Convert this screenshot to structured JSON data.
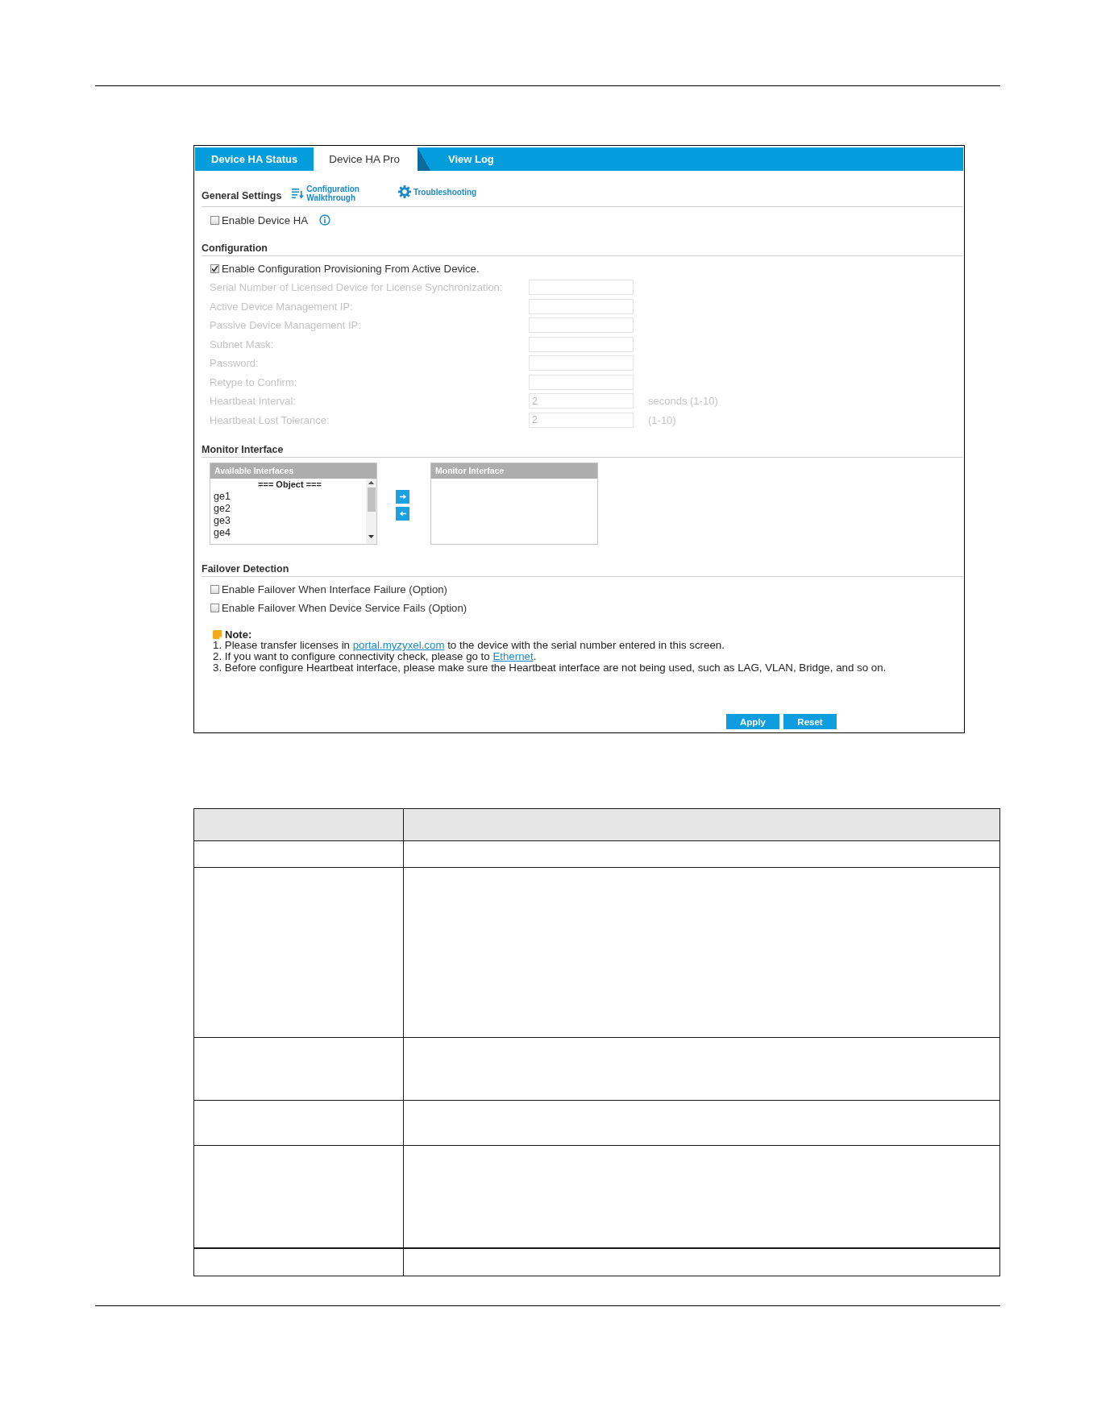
{
  "tabs": [
    {
      "label": "Device HA Status",
      "selected": false
    },
    {
      "label": "Device HA Pro",
      "selected": true
    },
    {
      "label": "View Log",
      "selected": false
    }
  ],
  "general_settings": {
    "title": "General Settings",
    "links": [
      {
        "kind": "walkthrough",
        "label": "Configuration Walkthrough"
      },
      {
        "kind": "troubleshooting",
        "label": "Troubleshooting"
      }
    ],
    "options": [
      {
        "label": "Enable Device HA",
        "checked": false,
        "info": true
      }
    ]
  },
  "configuration": {
    "title": "Configuration",
    "options": [
      {
        "label": "Enable Configuration Provisioning From Active Device.",
        "checked": true
      }
    ],
    "fields": [
      {
        "label": "Serial Number of Licensed Device for License Synchronization:",
        "disabled": true
      },
      {
        "label": "Active Device Management IP:",
        "disabled": true
      },
      {
        "label": "Passive Device Management IP:",
        "disabled": true
      },
      {
        "label": "Subnet Mask:",
        "disabled": true
      },
      {
        "label": "Password:",
        "disabled": true
      },
      {
        "label": "Retype to Confirm:",
        "disabled": true
      },
      {
        "label": "Heartbeat Interval:",
        "value": "2",
        "unit": "seconds (1-10)",
        "disabled": true
      },
      {
        "label": "Heartbeat Lost Tolerance:",
        "value": "2",
        "unit": "(1-10)",
        "disabled": true
      }
    ]
  },
  "monitor_interface": {
    "title": "Monitor Interface",
    "available": {
      "title": "Available Interfaces",
      "items": [
        {
          "kind": "group",
          "label": "=== Object ===",
          "selected": false
        },
        {
          "kind": "item",
          "label": "ge1",
          "selected": false
        },
        {
          "kind": "item",
          "label": "ge2",
          "selected": false
        },
        {
          "kind": "item",
          "label": "ge3",
          "selected": false
        },
        {
          "kind": "item",
          "label": "ge4",
          "selected": false
        }
      ]
    },
    "monitored": {
      "title": "Monitor Interface"
    }
  },
  "failover_detection": {
    "title": "Failover Detection",
    "options": [
      {
        "label": "Enable Failover When Interface Failure (Option)",
        "checked": false
      },
      {
        "label": "Enable Failover When Device Service Fails (Option)",
        "checked": false
      }
    ]
  },
  "note": {
    "title": "Note:",
    "lines": [
      {
        "before": "1. Please transfer licenses in ",
        "link": "portal.myzyxel.com",
        "after": " to the device with the serial number entered in this screen."
      },
      {
        "before": "2. If you want to configure connectivity check, please go to ",
        "link": "Ethernet",
        "after": "."
      },
      {
        "before": "3. Before configure Heartbeat interface, please make sure the Heartbeat interface are not being used, such as LAG, VLAN, Bridge, and so on."
      }
    ]
  },
  "buttons": [
    "Apply",
    "Reset"
  ]
}
